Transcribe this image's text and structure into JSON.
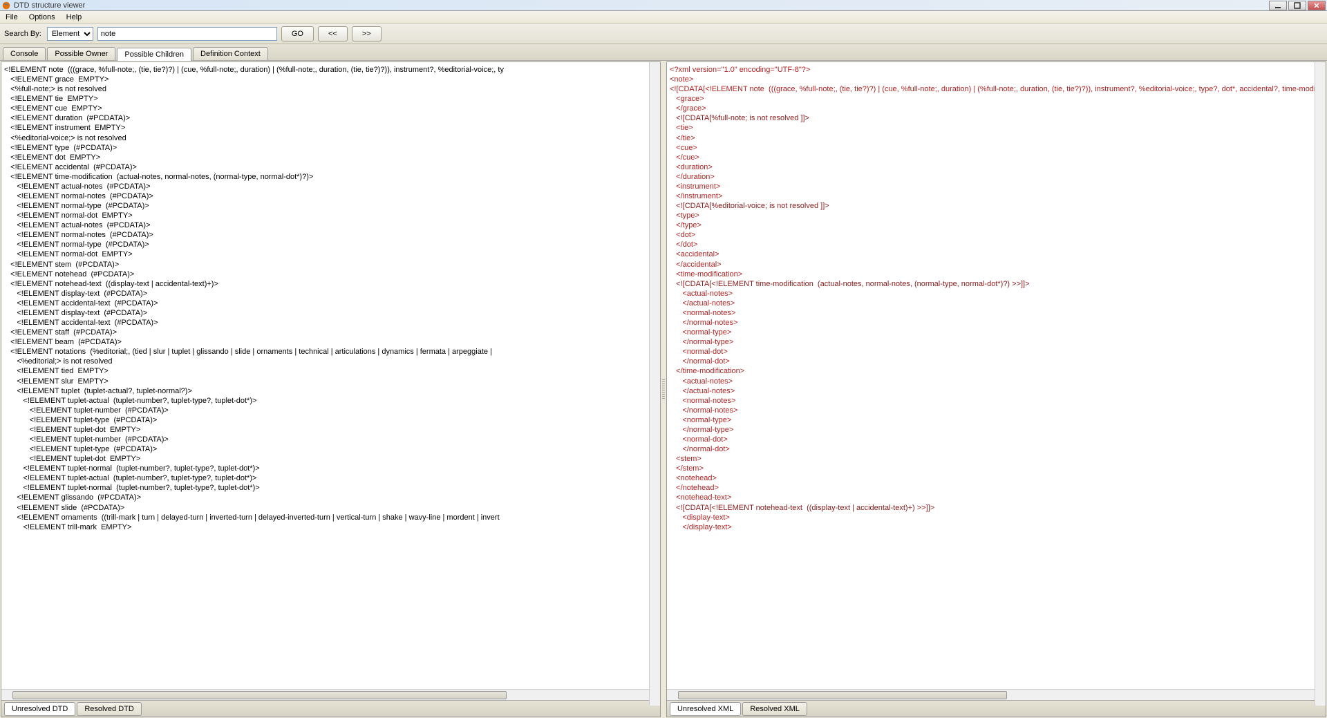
{
  "window": {
    "title": "DTD structure viewer"
  },
  "menu": {
    "file": "File",
    "options": "Options",
    "help": "Help"
  },
  "toolbar": {
    "search_by_label": "Search By:",
    "search_mode": "Element",
    "search_value": "note",
    "go": "GO",
    "prev": "<<",
    "next": ">>"
  },
  "tabs": {
    "console": "Console",
    "possible_owner": "Possible Owner",
    "possible_children": "Possible Children",
    "definition_context": "Definition Context"
  },
  "left_lines": [
    {
      "indent": 0,
      "text": "<!ELEMENT note  (((grace, %full-note;, (tie, tie?)?) | (cue, %full-note;, duration) | (%full-note;, duration, (tie, tie?)?)), instrument?, %editorial-voice;, ty"
    },
    {
      "indent": 1,
      "text": "<!ELEMENT grace  EMPTY>"
    },
    {
      "indent": 1,
      "text": "<%full-note;> is not resolved"
    },
    {
      "indent": 1,
      "text": "<!ELEMENT tie  EMPTY>"
    },
    {
      "indent": 1,
      "text": "<!ELEMENT cue  EMPTY>"
    },
    {
      "indent": 1,
      "text": "<!ELEMENT duration  (#PCDATA)>"
    },
    {
      "indent": 1,
      "text": "<!ELEMENT instrument  EMPTY>"
    },
    {
      "indent": 1,
      "text": "<%editorial-voice;> is not resolved"
    },
    {
      "indent": 1,
      "text": "<!ELEMENT type  (#PCDATA)>"
    },
    {
      "indent": 1,
      "text": "<!ELEMENT dot  EMPTY>"
    },
    {
      "indent": 1,
      "text": "<!ELEMENT accidental  (#PCDATA)>"
    },
    {
      "indent": 1,
      "text": "<!ELEMENT time-modification  (actual-notes, normal-notes, (normal-type, normal-dot*)?)>"
    },
    {
      "indent": 2,
      "text": "<!ELEMENT actual-notes  (#PCDATA)>"
    },
    {
      "indent": 2,
      "text": "<!ELEMENT normal-notes  (#PCDATA)>"
    },
    {
      "indent": 2,
      "text": "<!ELEMENT normal-type  (#PCDATA)>"
    },
    {
      "indent": 2,
      "text": "<!ELEMENT normal-dot  EMPTY>"
    },
    {
      "indent": 2,
      "text": "<!ELEMENT actual-notes  (#PCDATA)>"
    },
    {
      "indent": 2,
      "text": "<!ELEMENT normal-notes  (#PCDATA)>"
    },
    {
      "indent": 2,
      "text": "<!ELEMENT normal-type  (#PCDATA)>"
    },
    {
      "indent": 2,
      "text": "<!ELEMENT normal-dot  EMPTY>"
    },
    {
      "indent": 1,
      "text": "<!ELEMENT stem  (#PCDATA)>"
    },
    {
      "indent": 1,
      "text": "<!ELEMENT notehead  (#PCDATA)>"
    },
    {
      "indent": 1,
      "text": "<!ELEMENT notehead-text  ((display-text | accidental-text)+)>"
    },
    {
      "indent": 2,
      "text": "<!ELEMENT display-text  (#PCDATA)>"
    },
    {
      "indent": 2,
      "text": "<!ELEMENT accidental-text  (#PCDATA)>"
    },
    {
      "indent": 2,
      "text": "<!ELEMENT display-text  (#PCDATA)>"
    },
    {
      "indent": 2,
      "text": "<!ELEMENT accidental-text  (#PCDATA)>"
    },
    {
      "indent": 1,
      "text": "<!ELEMENT staff  (#PCDATA)>"
    },
    {
      "indent": 1,
      "text": "<!ELEMENT beam  (#PCDATA)>"
    },
    {
      "indent": 1,
      "text": "<!ELEMENT notations  (%editorial;, (tied | slur | tuplet | glissando | slide | ornaments | technical | articulations | dynamics | fermata | arpeggiate | "
    },
    {
      "indent": 2,
      "text": "<%editorial;> is not resolved"
    },
    {
      "indent": 2,
      "text": "<!ELEMENT tied  EMPTY>"
    },
    {
      "indent": 2,
      "text": "<!ELEMENT slur  EMPTY>"
    },
    {
      "indent": 2,
      "text": "<!ELEMENT tuplet  (tuplet-actual?, tuplet-normal?)>"
    },
    {
      "indent": 3,
      "text": "<!ELEMENT tuplet-actual  (tuplet-number?, tuplet-type?, tuplet-dot*)>"
    },
    {
      "indent": 4,
      "text": "<!ELEMENT tuplet-number  (#PCDATA)>"
    },
    {
      "indent": 4,
      "text": "<!ELEMENT tuplet-type  (#PCDATA)>"
    },
    {
      "indent": 4,
      "text": "<!ELEMENT tuplet-dot  EMPTY>"
    },
    {
      "indent": 4,
      "text": "<!ELEMENT tuplet-number  (#PCDATA)>"
    },
    {
      "indent": 4,
      "text": "<!ELEMENT tuplet-type  (#PCDATA)>"
    },
    {
      "indent": 4,
      "text": "<!ELEMENT tuplet-dot  EMPTY>"
    },
    {
      "indent": 3,
      "text": "<!ELEMENT tuplet-normal  (tuplet-number?, tuplet-type?, tuplet-dot*)>"
    },
    {
      "indent": 3,
      "text": "<!ELEMENT tuplet-actual  (tuplet-number?, tuplet-type?, tuplet-dot*)>"
    },
    {
      "indent": 3,
      "text": "<!ELEMENT tuplet-normal  (tuplet-number?, tuplet-type?, tuplet-dot*)>"
    },
    {
      "indent": 2,
      "text": "<!ELEMENT glissando  (#PCDATA)>"
    },
    {
      "indent": 2,
      "text": "<!ELEMENT slide  (#PCDATA)>"
    },
    {
      "indent": 2,
      "text": "<!ELEMENT ornaments  ((trill-mark | turn | delayed-turn | inverted-turn | delayed-inverted-turn | vertical-turn | shake | wavy-line | mordent | invert"
    },
    {
      "indent": 3,
      "text": "<!ELEMENT trill-mark  EMPTY>"
    }
  ],
  "right_lines": [
    {
      "indent": 0,
      "cls": "red",
      "text": "<?xml version=\"1.0\" encoding=\"UTF-8\"?>"
    },
    {
      "indent": 0,
      "cls": "red",
      "text": "<note>"
    },
    {
      "indent": 0,
      "cls": "red",
      "text": "<![CDATA[<!ELEMENT note  (((grace, %full-note;, (tie, tie?)?) | (cue, %full-note;, duration) | (%full-note;, duration, (tie, tie?)?)), instrument?, %editorial-voice;, type?, dot*, accidental?, time-modificatio"
    },
    {
      "indent": 1,
      "cls": "red",
      "text": "<grace>"
    },
    {
      "indent": 1,
      "cls": "red",
      "text": "</grace>"
    },
    {
      "indent": 1,
      "cls": "darkred",
      "text": "<![CDATA[%full-note; is not resolved ]]>"
    },
    {
      "indent": 1,
      "cls": "red",
      "text": "<tie>"
    },
    {
      "indent": 1,
      "cls": "red",
      "text": "</tie>"
    },
    {
      "indent": 1,
      "cls": "red",
      "text": "<cue>"
    },
    {
      "indent": 1,
      "cls": "red",
      "text": "</cue>"
    },
    {
      "indent": 1,
      "cls": "red",
      "text": "<duration>"
    },
    {
      "indent": 1,
      "cls": "red",
      "text": "</duration>"
    },
    {
      "indent": 1,
      "cls": "red",
      "text": "<instrument>"
    },
    {
      "indent": 1,
      "cls": "red",
      "text": "</instrument>"
    },
    {
      "indent": 1,
      "cls": "darkred",
      "text": "<![CDATA[%editorial-voice; is not resolved ]]>"
    },
    {
      "indent": 1,
      "cls": "red",
      "text": "<type>"
    },
    {
      "indent": 1,
      "cls": "red",
      "text": "</type>"
    },
    {
      "indent": 1,
      "cls": "red",
      "text": "<dot>"
    },
    {
      "indent": 1,
      "cls": "red",
      "text": "</dot>"
    },
    {
      "indent": 1,
      "cls": "red",
      "text": "<accidental>"
    },
    {
      "indent": 1,
      "cls": "red",
      "text": "</accidental>"
    },
    {
      "indent": 1,
      "cls": "red",
      "text": "<time-modification>"
    },
    {
      "indent": 1,
      "cls": "darkred",
      "text": "<![CDATA[<!ELEMENT time-modification  (actual-notes, normal-notes, (normal-type, normal-dot*)?) >>]]>"
    },
    {
      "indent": 2,
      "cls": "red",
      "text": "<actual-notes>"
    },
    {
      "indent": 2,
      "cls": "red",
      "text": "</actual-notes>"
    },
    {
      "indent": 2,
      "cls": "red",
      "text": "<normal-notes>"
    },
    {
      "indent": 2,
      "cls": "red",
      "text": "</normal-notes>"
    },
    {
      "indent": 2,
      "cls": "red",
      "text": "<normal-type>"
    },
    {
      "indent": 2,
      "cls": "red",
      "text": "</normal-type>"
    },
    {
      "indent": 2,
      "cls": "red",
      "text": "<normal-dot>"
    },
    {
      "indent": 2,
      "cls": "red",
      "text": "</normal-dot>"
    },
    {
      "indent": 1,
      "cls": "red",
      "text": "</time-modification>"
    },
    {
      "indent": 2,
      "cls": "red",
      "text": "<actual-notes>"
    },
    {
      "indent": 2,
      "cls": "red",
      "text": "</actual-notes>"
    },
    {
      "indent": 2,
      "cls": "red",
      "text": "<normal-notes>"
    },
    {
      "indent": 2,
      "cls": "red",
      "text": "</normal-notes>"
    },
    {
      "indent": 2,
      "cls": "red",
      "text": "<normal-type>"
    },
    {
      "indent": 2,
      "cls": "red",
      "text": "</normal-type>"
    },
    {
      "indent": 2,
      "cls": "red",
      "text": "<normal-dot>"
    },
    {
      "indent": 2,
      "cls": "red",
      "text": "</normal-dot>"
    },
    {
      "indent": 1,
      "cls": "red",
      "text": "<stem>"
    },
    {
      "indent": 1,
      "cls": "red",
      "text": "</stem>"
    },
    {
      "indent": 1,
      "cls": "red",
      "text": "<notehead>"
    },
    {
      "indent": 1,
      "cls": "red",
      "text": "</notehead>"
    },
    {
      "indent": 1,
      "cls": "red",
      "text": "<notehead-text>"
    },
    {
      "indent": 1,
      "cls": "darkred",
      "text": "<![CDATA[<!ELEMENT notehead-text  ((display-text | accidental-text)+) >>]]>"
    },
    {
      "indent": 2,
      "cls": "red",
      "text": "<display-text>"
    },
    {
      "indent": 2,
      "cls": "red",
      "text": "</display-text>"
    }
  ],
  "bottom_tabs_left": {
    "unresolved_dtd": "Unresolved DTD",
    "resolved_dtd": "Resolved DTD"
  },
  "bottom_tabs_right": {
    "unresolved_xml": "Unresolved XML",
    "resolved_xml": "Resolved XML"
  }
}
